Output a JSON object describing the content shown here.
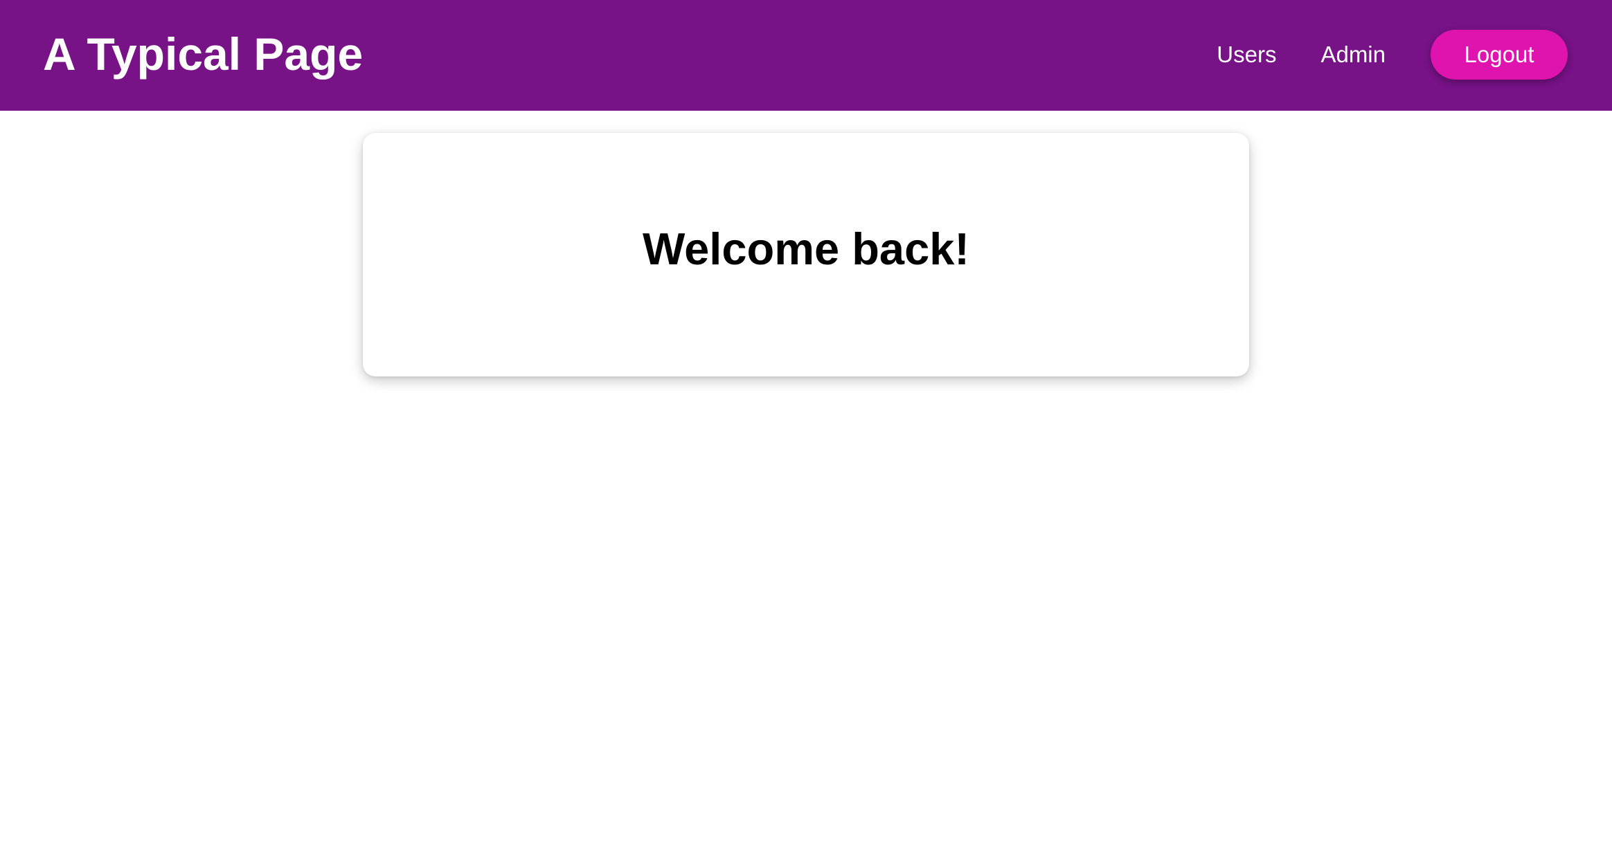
{
  "header": {
    "title": "A Typical Page",
    "background_color": "#771287",
    "nav": {
      "links": [
        {
          "label": "Users"
        },
        {
          "label": "Admin"
        }
      ],
      "logout_label": "Logout",
      "logout_color": "#df14ae"
    }
  },
  "main": {
    "welcome_card": {
      "heading": "Welcome back!"
    }
  }
}
